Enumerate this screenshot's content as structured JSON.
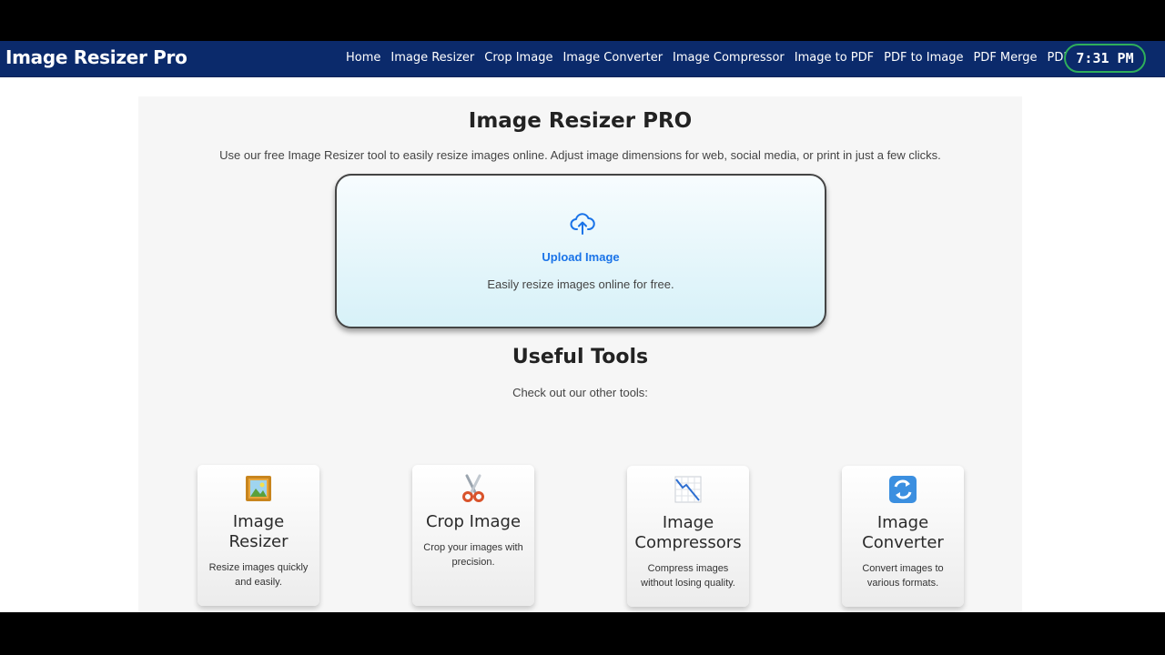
{
  "header": {
    "brand": "Image Resizer Pro",
    "nav": [
      "Home",
      "Image Resizer",
      "Crop Image",
      "Image Converter",
      "Image Compressor",
      "Image to PDF",
      "PDF to Image",
      "PDF Merge",
      "PDF Split"
    ],
    "clock": "7:31 PM"
  },
  "main": {
    "title": "Image Resizer PRO",
    "subtitle": "Use our free Image Resizer tool to easily resize images online. Adjust image dimensions for web, social media, or print in just a few clicks.",
    "upload": {
      "icon": "cloud-upload-icon",
      "label": "Upload Image",
      "description": "Easily resize images online for free."
    },
    "tools_heading": "Useful Tools",
    "tools_subheading": "Check out our other tools:",
    "tools": [
      {
        "icon": "framed-picture-icon",
        "name": "Image Resizer",
        "description": "Resize images quickly and easily."
      },
      {
        "icon": "scissors-icon",
        "name": "Crop Image",
        "description": "Crop your images with precision."
      },
      {
        "icon": "chart-decreasing-icon",
        "name": "Image Compressors",
        "description": "Compress images without losing quality."
      },
      {
        "icon": "arrows-cycle-icon",
        "name": "Image Converter",
        "description": "Convert images to various formats."
      }
    ],
    "tools_row2_icons": [
      "document-icon",
      "document-icon",
      "document-pencil-icon",
      "document-icon"
    ]
  },
  "colors": {
    "navbar": "#0b2a6b",
    "accent": "#1a73e8",
    "clock_border": "#2fae5a"
  }
}
